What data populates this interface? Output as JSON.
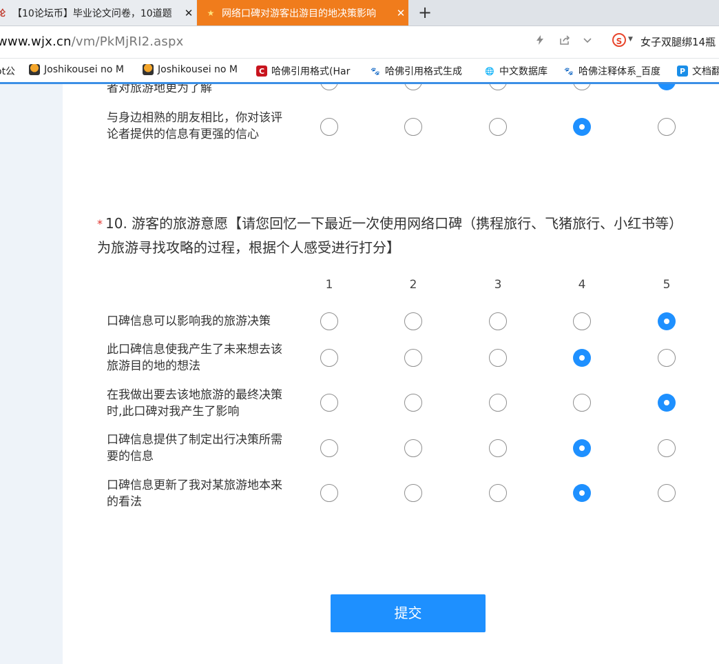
{
  "browser": {
    "tabs": [
      {
        "favicon": "论",
        "title": "【10论坛币】毕业论文问卷，10道题",
        "active": false
      },
      {
        "favicon": "★",
        "title": "网络口碑对游客出游目的地决策影响",
        "active": true
      }
    ],
    "close_glyph": "✕",
    "new_tab_glyph": "+",
    "url_host": "www.wjx.cn",
    "url_path": "/vm/PkMjRI2.aspx",
    "search_engine_glyph": "S",
    "search_text": "女子双腿绑14瓶",
    "bookmarks": [
      {
        "icon": "",
        "label": "ot公"
      },
      {
        "icon": "penguin-icon",
        "label": "Joshikousei no M"
      },
      {
        "icon": "penguin-icon",
        "label": "Joshikousei no M"
      },
      {
        "icon": "citation-c-icon",
        "label": "哈佛引用格式(Har"
      },
      {
        "icon": "baidu-paw-icon",
        "label": "哈佛引用格式生成"
      },
      {
        "icon": "globe-icon",
        "label": "中文数据库"
      },
      {
        "icon": "baidu-paw-icon",
        "label": "哈佛注释体系_百度"
      },
      {
        "icon": "p-doc-icon",
        "label": "文档翻"
      }
    ]
  },
  "prev_question": {
    "rows": [
      {
        "label": "者对旅游地更为了解",
        "selected": 5
      },
      {
        "label": "与身边相熟的朋友相比，你对该评论者提供的信息有更强的信心",
        "selected": 4
      }
    ]
  },
  "question": {
    "required_mark": "*",
    "title": "10. 游客的旅游意愿【请您回忆一下最近一次使用网络口碑（携程旅行、飞猪旅行、小红书等）为旅游寻找攻略的过程，根据个人感受进行打分】",
    "scale": [
      "1",
      "2",
      "3",
      "4",
      "5"
    ],
    "rows": [
      {
        "label": "口碑信息可以影响我的旅游决策",
        "selected": 5
      },
      {
        "label": "此口碑信息使我产生了未来想去该旅游目的地的想法",
        "selected": 4
      },
      {
        "label": "在我做出要去该地旅游的最终决策时,此口碑对我产生了影响",
        "selected": 5
      },
      {
        "label": "口碑信息提供了制定出行决策所需要的信息",
        "selected": 4
      },
      {
        "label": "口碑信息更新了我对某旅游地本来的看法",
        "selected": 4
      }
    ]
  },
  "submit_label": "提交",
  "accent_color": "#1e90ff"
}
